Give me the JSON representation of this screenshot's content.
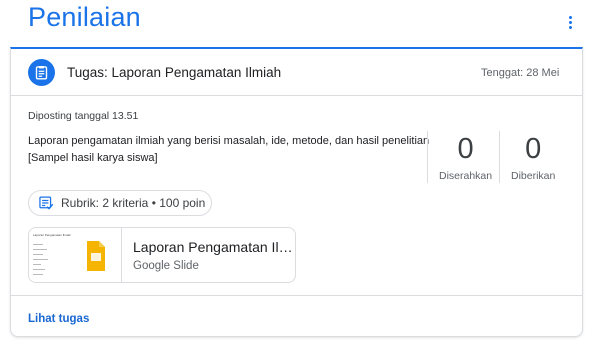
{
  "header": {
    "title": "Penilaian",
    "more_icon": "more-vert-icon"
  },
  "assignment": {
    "icon": "assignment-icon",
    "title": "Tugas: Laporan Pengamatan Ilmiah",
    "due": "Tenggat: 28 Mei",
    "posted": "Diposting tanggal 13.51",
    "description_line1": "Laporan pengamatan ilmiah yang berisi masalah, ide, metode, dan hasil penelitian",
    "description_line2": "[Sampel hasil karya siswa]",
    "stats": [
      {
        "value": "0",
        "label": "Diserahkan"
      },
      {
        "value": "0",
        "label": "Diberikan"
      }
    ],
    "rubric": {
      "icon": "rubric-icon",
      "label": "Rubrik: 2 kriteria • 100 poin"
    },
    "attachment": {
      "title": "Laporan Pengamatan Ilmi...",
      "type": "Google Slide",
      "thumb_title": "Laporan Pengamatan Ilmiah"
    },
    "view_link": "Lihat tugas"
  },
  "colors": {
    "accent": "#1a73e8",
    "slides_yellow": "#f4b400",
    "border": "#dadce0"
  }
}
